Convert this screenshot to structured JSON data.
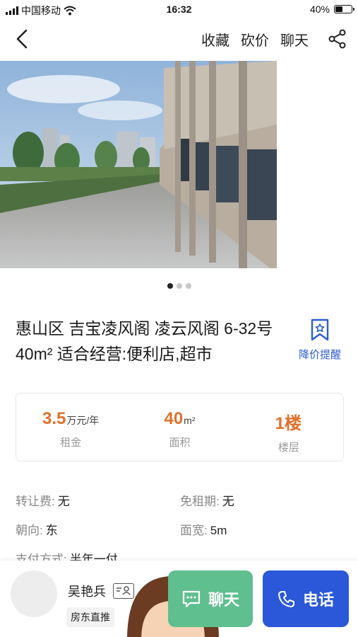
{
  "status_bar": {
    "carrier": "中国移动",
    "time": "16:32",
    "battery": "40%",
    "battery_level": 0.4
  },
  "nav": {
    "actions": [
      "收藏",
      "砍价",
      "聊天"
    ],
    "icons": {
      "back": "back-arrow-icon",
      "share": "share-icon"
    }
  },
  "gallery": {
    "page_count": 3,
    "current": 1
  },
  "listing": {
    "title": "惠山区 吉宝凌风阁 凌云风阁 6-32号 40m² 适合经营:便利店,超市",
    "price_alert": "降价提醒"
  },
  "stats": [
    {
      "value": "3.5",
      "unit": "万元/年",
      "label": "租金"
    },
    {
      "value": "40",
      "unit": "m²",
      "label": "面积"
    },
    {
      "value": "1楼",
      "unit": "",
      "label": "楼层"
    }
  ],
  "details": [
    [
      {
        "key": "转让费:",
        "value": "无"
      },
      {
        "key": "免租期:",
        "value": "无"
      }
    ],
    [
      {
        "key": "朝向:",
        "value": "东"
      },
      {
        "key": "面宽:",
        "value": "5m"
      }
    ],
    [
      {
        "key": "支付方式:",
        "value": "半年一付"
      }
    ]
  ],
  "agent": {
    "name": "吴艳兵",
    "tag": "房东直推"
  },
  "buttons": {
    "chat": "聊天",
    "call": "电话"
  },
  "colors": {
    "accent_orange": "#e0702b",
    "blue": "#2a58d9",
    "green": "#5fbf8e"
  }
}
